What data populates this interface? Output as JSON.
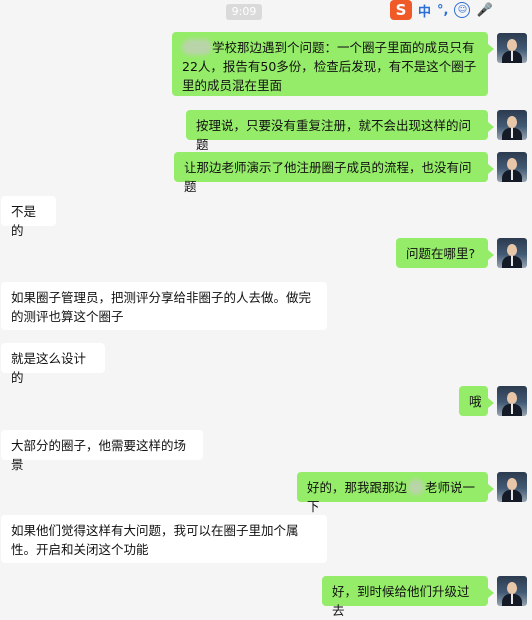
{
  "status": {
    "time": "9:09"
  },
  "ime": {
    "logo": "S",
    "mode": "中",
    "punct": "°,",
    "emoji": "☺",
    "voice": "🎤"
  },
  "messages": [
    {
      "side": "out",
      "text_before": "",
      "text": "学校那边遇到个问题：一个圈子里面的成员只有22人，报告有50多份，检查后发现，有不是这个圈子里的成员混在里面"
    },
    {
      "side": "out",
      "text": "按理说，只要没有重复注册，就不会出现这样的问题"
    },
    {
      "side": "out",
      "text": "让那边老师演示了他注册圈子成员的流程，也没有问题"
    },
    {
      "side": "in",
      "text": "不是的"
    },
    {
      "side": "out",
      "text": "问题在哪里?"
    },
    {
      "side": "in",
      "text": "如果圈子管理员，把测评分享给非圈子的人去做。做完的测评也算这个圈子"
    },
    {
      "side": "in",
      "text": "就是这么设计的"
    },
    {
      "side": "out",
      "text": "哦"
    },
    {
      "side": "in",
      "text": "大部分的圈子，他需要这样的场景"
    },
    {
      "side": "out",
      "text_a": "好的，那我跟那边",
      "text_b": "老师说一下"
    },
    {
      "side": "in",
      "text": "如果他们觉得这样有大问题，我可以在圈子里加个属性。开启和关闭这个功能"
    },
    {
      "side": "out",
      "text": "好，到时候给他们升级过去"
    }
  ]
}
